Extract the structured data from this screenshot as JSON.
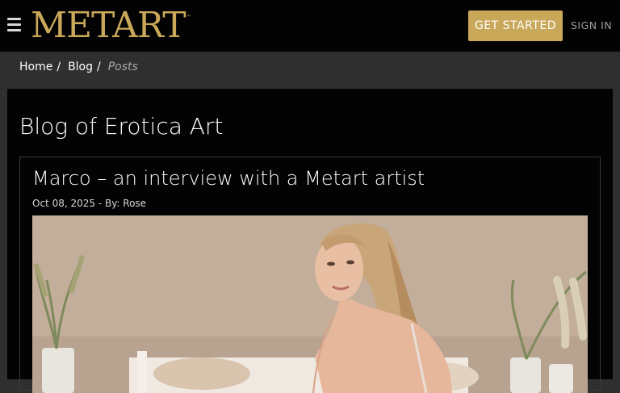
{
  "header": {
    "logo_text": "METART",
    "logo_tm": "™",
    "cta_label": "GET STARTED",
    "signin_label": "SIGN IN"
  },
  "breadcrumb": {
    "items": [
      "Home",
      "Blog"
    ],
    "current": "Posts",
    "separator": "/"
  },
  "page": {
    "title": "Blog of Erotica Art"
  },
  "post": {
    "title": "Marco – an interview with a Metart artist",
    "meta": "Oct 08, 2025 - By: Rose",
    "image_alt": "post-featured-photo"
  },
  "colors": {
    "brand_gold": "#c9a85a",
    "topbar_bg": "#030303",
    "page_bg": "#2f2f2f"
  }
}
